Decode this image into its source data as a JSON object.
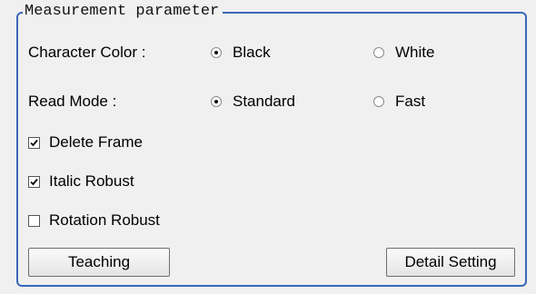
{
  "group": {
    "title": "Measurement parameter"
  },
  "character_color": {
    "label": "Character Color :",
    "options": [
      {
        "label": "Black",
        "checked": true
      },
      {
        "label": "White",
        "checked": false
      }
    ]
  },
  "read_mode": {
    "label": "Read Mode :",
    "options": [
      {
        "label": "Standard",
        "checked": true
      },
      {
        "label": "Fast",
        "checked": false
      }
    ]
  },
  "checkboxes": [
    {
      "label": "Delete Frame",
      "checked": true
    },
    {
      "label": "Italic Robust",
      "checked": true
    },
    {
      "label": "Rotation Robust",
      "checked": false
    }
  ],
  "buttons": {
    "teaching": "Teaching",
    "detail_setting": "Detail Setting"
  }
}
